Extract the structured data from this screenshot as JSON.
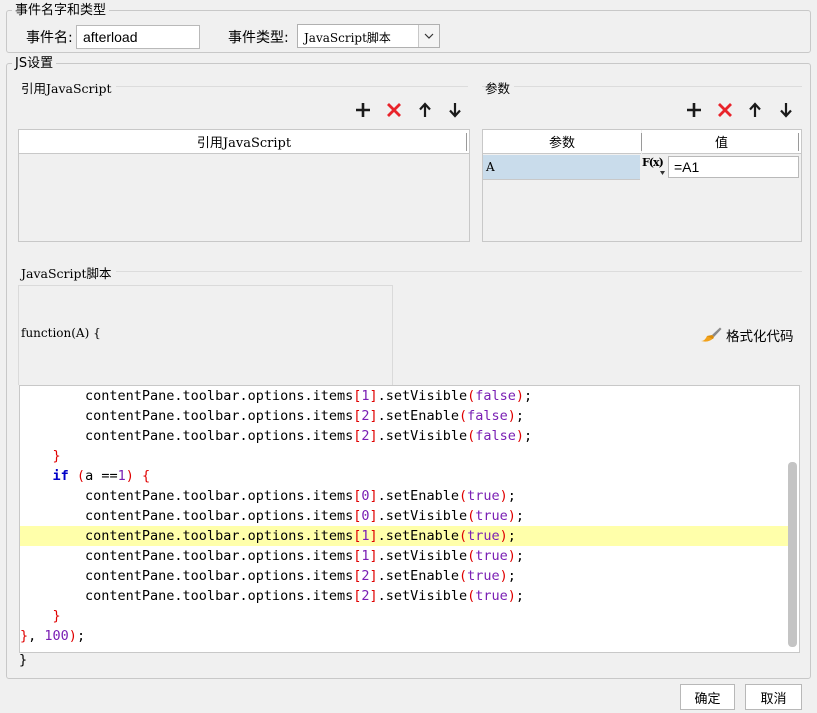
{
  "event_group": {
    "legend": "事件名字和类型",
    "name_label": "事件名:",
    "name_value": "afterload",
    "type_label": "事件类型:",
    "type_value": "JavaScript脚本"
  },
  "js_group": {
    "legend": "JS设置",
    "ref_js": {
      "legend": "引用JavaScript",
      "column_header": "引用JavaScript"
    },
    "params": {
      "legend": "参数",
      "columns": [
        "参数",
        "值"
      ],
      "rows": [
        {
          "name": "A",
          "fx_label": "F(x)",
          "value": "=A1"
        }
      ]
    },
    "script": {
      "legend": "JavaScript脚本",
      "signature": "function(A) {",
      "format_label": "格式化代码",
      "closing": "}"
    }
  },
  "code_lines": [
    "        contentPane.toolbar.options.items[1].setVisible(false);",
    "        contentPane.toolbar.options.items[2].setEnable(false);",
    "        contentPane.toolbar.options.items[2].setVisible(false);",
    "    }",
    "    if (a ==1) {",
    "        contentPane.toolbar.options.items[0].setEnable(true);",
    "        contentPane.toolbar.options.items[0].setVisible(true);",
    "        contentPane.toolbar.options.items[1].setEnable(true);",
    "        contentPane.toolbar.options.items[1].setVisible(true);",
    "        contentPane.toolbar.options.items[2].setEnable(true);",
    "        contentPane.toolbar.options.items[2].setVisible(true);",
    "    }",
    "}, 100);"
  ],
  "highlighted_line": 7,
  "buttons": {
    "ok": "确定",
    "cancel": "取消"
  },
  "colors": {
    "add": "#1a1a1a",
    "delete": "#e8232a",
    "selected_cell": "#c9dceb",
    "highlight_line": "#ffffaa",
    "keyword": "#0000c8",
    "bracket": "#e00000",
    "literal": "#7a1fb4"
  },
  "icons": {
    "add": "plus-icon",
    "delete": "cross-icon",
    "up": "arrow-up-icon",
    "down": "arrow-down-icon",
    "dropdown": "chevron-down-icon",
    "format": "brush-icon"
  }
}
